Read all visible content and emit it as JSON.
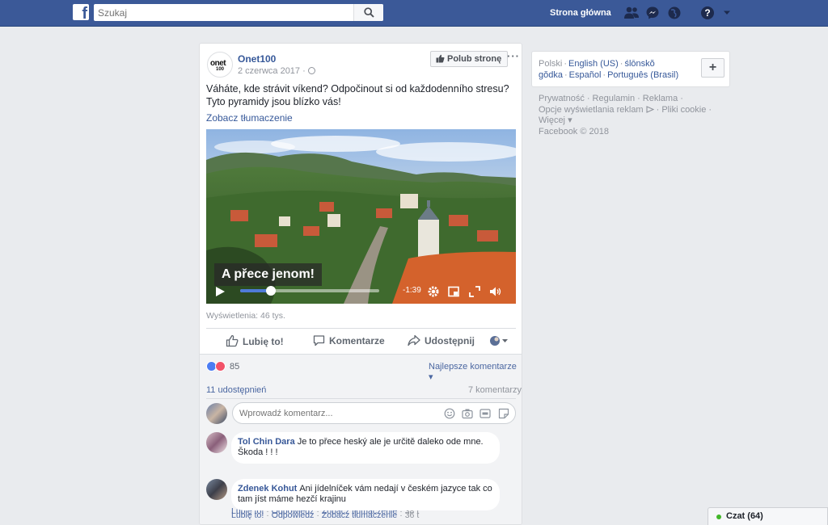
{
  "topbar": {
    "logo": "f",
    "search_placeholder": "Szukaj",
    "home_label": "Strona główna",
    "icons": [
      "friends-icon",
      "messenger-icon",
      "notifications-globe-icon",
      "help-icon",
      "caret-down-icon"
    ],
    "bar_color": "#3b5998"
  },
  "post": {
    "page_name": "Onet100",
    "avatar_text": "onet",
    "avatar_sub": "100",
    "date": "2 czerwca 2017 ·",
    "like_page_label": "Polub stronę",
    "more": "···",
    "text": "Váháte, kde strávit víkend? Odpočinout si od každodenního stresu? Tyto pyramidy jsou blízko vás!",
    "see_translation": "Zobacz tłumaczenie",
    "video": {
      "caption": "A přece jenom!",
      "time": "-1:39",
      "progress": 0.22
    },
    "views": "Wyświetlenia: 46 tys.",
    "actions": {
      "like": "Lubię to!",
      "comment": "Komentarze",
      "share": "Udostępnij"
    },
    "reaction_count": "85",
    "best_comments": "Najlepsze komentarze ▾",
    "shares": "11 udostępnień",
    "comment_count": "7 komentarzy",
    "comment_placeholder": "Wprowadź komentarz...",
    "comments": [
      {
        "name": "Tol Chin Dara",
        "text": "Je to přece heský ale je určitě daleko ode mne. Škoda ! ! !",
        "like": "Lubię to!",
        "reply": "Odpowiedz",
        "translate": "Zobacz tłumaczenie",
        "time": "38 t"
      },
      {
        "name": "Zdenek Kohut",
        "text": "Ani jídelníček vám nedají v českém jazyce tak co tam jíst máme hezčí krajinu",
        "like": "Lubię to!",
        "reply": "Odpowiedz",
        "translate": "Zobacz tłumaczenie",
        "time": "36 t"
      }
    ]
  },
  "sidebar": {
    "languages": {
      "current": "Polski",
      "others": [
        "English (US)",
        "ślōnskŏ gŏdka",
        "Español",
        "Português (Brasil)"
      ]
    },
    "add_label": "+",
    "footer": [
      "Prywatność",
      "Regulamin",
      "Reklama",
      "Opcje wyświetlania reklam",
      "Pliki cookie",
      "Więcej",
      "Facebook © 2018"
    ]
  },
  "chat": {
    "label": "Czat (64)"
  }
}
